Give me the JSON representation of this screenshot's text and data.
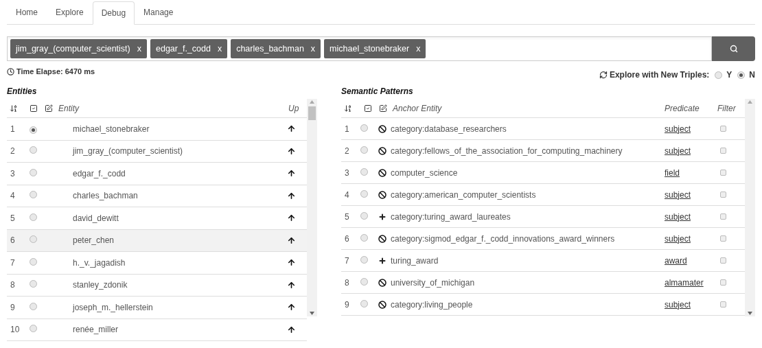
{
  "tabs": [
    {
      "label": "Home",
      "selected": false
    },
    {
      "label": "Explore",
      "selected": false
    },
    {
      "label": "Debug",
      "selected": true
    },
    {
      "label": "Manage",
      "selected": false
    }
  ],
  "search": {
    "tags": [
      {
        "label": "jim_gray_(computer_scientist)",
        "remove": "x"
      },
      {
        "label": "edgar_f._codd",
        "remove": "x"
      },
      {
        "label": "charles_bachman",
        "remove": "x"
      },
      {
        "label": "michael_stonebraker",
        "remove": "x"
      }
    ]
  },
  "time_elapse": "Time Elapse: 6470 ms",
  "explore_option": {
    "label": "Explore with New Triples:",
    "options": [
      {
        "label": "Y",
        "selected": false
      },
      {
        "label": "N",
        "selected": true
      }
    ]
  },
  "entities": {
    "title": "Entities",
    "columns": {
      "entity": "Entity",
      "up": "Up"
    },
    "rows": [
      {
        "rank": "1",
        "entity": "michael_stonebraker",
        "selected": true,
        "highlighted": false
      },
      {
        "rank": "2",
        "entity": "jim_gray_(computer_scientist)",
        "selected": false,
        "highlighted": false
      },
      {
        "rank": "3",
        "entity": "edgar_f._codd",
        "selected": false,
        "highlighted": false
      },
      {
        "rank": "4",
        "entity": "charles_bachman",
        "selected": false,
        "highlighted": false
      },
      {
        "rank": "5",
        "entity": "david_dewitt",
        "selected": false,
        "highlighted": false
      },
      {
        "rank": "6",
        "entity": "peter_chen",
        "selected": false,
        "highlighted": true
      },
      {
        "rank": "7",
        "entity": "h._v._jagadish",
        "selected": false,
        "highlighted": false
      },
      {
        "rank": "8",
        "entity": "stanley_zdonik",
        "selected": false,
        "highlighted": false
      },
      {
        "rank": "9",
        "entity": "joseph_m._hellerstein",
        "selected": false,
        "highlighted": false
      },
      {
        "rank": "10",
        "entity": "renée_miller",
        "selected": false,
        "highlighted": false
      }
    ]
  },
  "patterns": {
    "title": "Semantic Patterns",
    "columns": {
      "anchor": "Anchor Entity",
      "predicate": "Predicate",
      "filter": "Filter"
    },
    "rows": [
      {
        "rank": "1",
        "kind": "blocked",
        "anchor": "category:database_researchers",
        "predicate": "subject",
        "selected": false,
        "filter": false
      },
      {
        "rank": "2",
        "kind": "blocked",
        "anchor": "category:fellows_of_the_association_for_computing_machinery",
        "predicate": "subject",
        "selected": false,
        "filter": false
      },
      {
        "rank": "3",
        "kind": "blocked",
        "anchor": "computer_science",
        "predicate": "field",
        "selected": false,
        "filter": false
      },
      {
        "rank": "4",
        "kind": "blocked",
        "anchor": "category:american_computer_scientists",
        "predicate": "subject",
        "selected": false,
        "filter": false
      },
      {
        "rank": "5",
        "kind": "added",
        "anchor": "category:turing_award_laureates",
        "predicate": "subject",
        "selected": false,
        "filter": false
      },
      {
        "rank": "6",
        "kind": "blocked",
        "anchor": "category:sigmod_edgar_f._codd_innovations_award_winners",
        "predicate": "subject",
        "selected": false,
        "filter": false
      },
      {
        "rank": "7",
        "kind": "added",
        "anchor": "turing_award",
        "predicate": "award",
        "selected": false,
        "filter": false
      },
      {
        "rank": "8",
        "kind": "blocked",
        "anchor": "university_of_michigan",
        "predicate": "almamater",
        "selected": false,
        "filter": false
      },
      {
        "rank": "9",
        "kind": "blocked",
        "anchor": "category:living_people",
        "predicate": "subject",
        "selected": false,
        "filter": false
      }
    ]
  }
}
